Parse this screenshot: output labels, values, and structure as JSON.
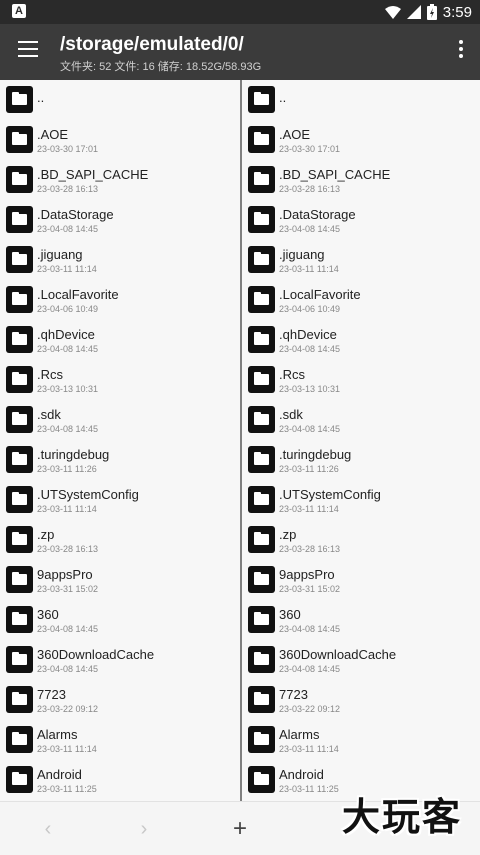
{
  "status": {
    "time": "3:59"
  },
  "toolbar": {
    "path": "/storage/emulated/0/",
    "info": "文件夹: 52  文件: 16  储存: 18.52G/58.93G"
  },
  "entries": [
    {
      "name": "..",
      "date": ""
    },
    {
      "name": ".AOE",
      "date": "23-03-30 17:01"
    },
    {
      "name": ".BD_SAPI_CACHE",
      "date": "23-03-28 16:13"
    },
    {
      "name": ".DataStorage",
      "date": "23-04-08 14:45"
    },
    {
      "name": ".jiguang",
      "date": "23-03-11 11:14"
    },
    {
      "name": ".LocalFavorite",
      "date": "23-04-06 10:49"
    },
    {
      "name": ".qhDevice",
      "date": "23-04-08 14:45"
    },
    {
      "name": ".Rcs",
      "date": "23-03-13 10:31"
    },
    {
      "name": ".sdk",
      "date": "23-04-08 14:45"
    },
    {
      "name": ".turingdebug",
      "date": "23-03-11 11:26"
    },
    {
      "name": ".UTSystemConfig",
      "date": "23-03-11 11:14"
    },
    {
      "name": ".zp",
      "date": "23-03-28 16:13"
    },
    {
      "name": "9appsPro",
      "date": "23-03-31 15:02"
    },
    {
      "name": "360",
      "date": "23-04-08 14:45"
    },
    {
      "name": "360DownloadCache",
      "date": "23-04-08 14:45"
    },
    {
      "name": "7723",
      "date": "23-03-22 09:12"
    },
    {
      "name": "Alarms",
      "date": "23-03-11 11:14"
    },
    {
      "name": "Android",
      "date": "23-03-11 11:25"
    }
  ],
  "bottom": {
    "back": "‹",
    "forward": "›",
    "add": "+"
  },
  "watermark": "大玩客"
}
